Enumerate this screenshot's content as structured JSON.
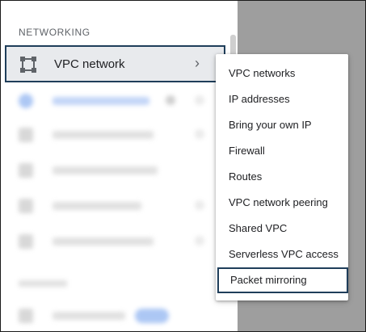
{
  "sidebar": {
    "section_title": "NETWORKING",
    "selected_item": {
      "label": "VPC network",
      "icon": "vpc-network-icon",
      "chevron": "›"
    }
  },
  "flyout": {
    "items": [
      {
        "label": "VPC networks"
      },
      {
        "label": "IP addresses"
      },
      {
        "label": "Bring your own IP"
      },
      {
        "label": "Firewall"
      },
      {
        "label": "Routes"
      },
      {
        "label": "VPC network peering"
      },
      {
        "label": "Shared VPC"
      },
      {
        "label": "Serverless VPC access"
      },
      {
        "label": "Packet mirroring",
        "highlighted": true
      }
    ]
  },
  "colors": {
    "highlight_border": "#1f3e5a",
    "selected_bg": "#e8eaed",
    "backdrop": "#9e9e9e",
    "text": "#202124"
  }
}
